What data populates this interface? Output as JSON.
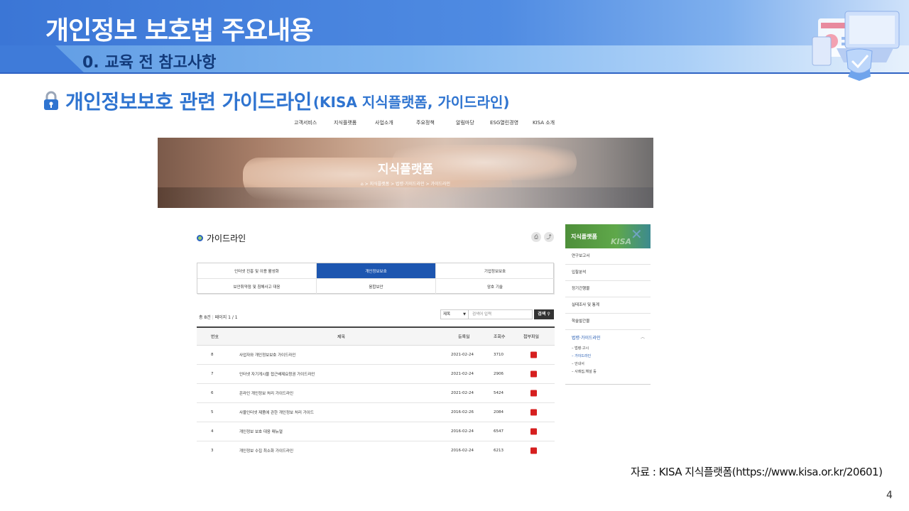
{
  "slide": {
    "title": "개인정보 보호법 주요내용",
    "subtitle": "0. 교육 전 참고사항",
    "section_main": "개인정보보호 관련 가이드라인",
    "section_paren": "(KISA 지식플랫폼, 가이드라인)",
    "source": "자료 : KISA 지식플랫폼(https://www.kisa.or.kr/20601)",
    "page_number": "4"
  },
  "site": {
    "nav": [
      "고객서비스",
      "지식플랫폼",
      "사업소개",
      "주요정책",
      "알림마당",
      "ESG열린경영",
      "KISA 소개"
    ],
    "banner_title": "지식플랫폼",
    "breadcrumb": [
      "⌂",
      "지식플랫폼",
      "법령·가이드라인",
      "가이드라인"
    ],
    "page_title": "가이드라인",
    "tools": [
      "⎙",
      "⤴"
    ],
    "tabs": [
      {
        "label": "인터넷 진흥 및 이용 활성화",
        "active": false
      },
      {
        "label": "개인정보보호",
        "active": true
      },
      {
        "label": "기업정보보호",
        "active": false
      },
      {
        "label": "보안취약점 및 침해사고 대응",
        "active": false
      },
      {
        "label": "융합보안",
        "active": false
      },
      {
        "label": "암호 기술",
        "active": false
      }
    ],
    "count": "총 8건",
    "page_info": "페이지 1 / 1",
    "search": {
      "select": "제목",
      "placeholder": "검색어 입력",
      "button": "검색"
    },
    "table": {
      "headers": [
        "번호",
        "제목",
        "등록일",
        "조회수",
        "첨부파일"
      ],
      "rows": [
        {
          "no": "8",
          "title": "사업자와 개인정보보호 가이드라인",
          "date": "2021-02-24",
          "views": "3710"
        },
        {
          "no": "7",
          "title": "인터넷 자기게시물 접근배제요청권 가이드라인",
          "date": "2021-02-24",
          "views": "2906"
        },
        {
          "no": "6",
          "title": "온라인 개인정보 처리 가이드라인",
          "date": "2021-02-24",
          "views": "5424"
        },
        {
          "no": "5",
          "title": "사물인터넷 제품에 관한 개인정보 처리 가이드",
          "date": "2016-02-26",
          "views": "2084"
        },
        {
          "no": "4",
          "title": "개인정보 보호 대응 매뉴얼",
          "date": "2016-02-24",
          "views": "6547"
        },
        {
          "no": "3",
          "title": "개인정보 수집 최소화 가이드라인",
          "date": "2016-02-24",
          "views": "6213"
        }
      ]
    },
    "sidebar": {
      "title": "지식플랫폼",
      "logo": "KISA",
      "items": [
        "연구보고서",
        "입찰분석",
        "정기간행물",
        "실태조사 및 통계",
        "학술발간물"
      ],
      "open_item": "법령·가이드라인",
      "sub_items": [
        "법령·고시",
        "가이드라인",
        "안내서",
        "사례집,해설 등"
      ]
    }
  }
}
